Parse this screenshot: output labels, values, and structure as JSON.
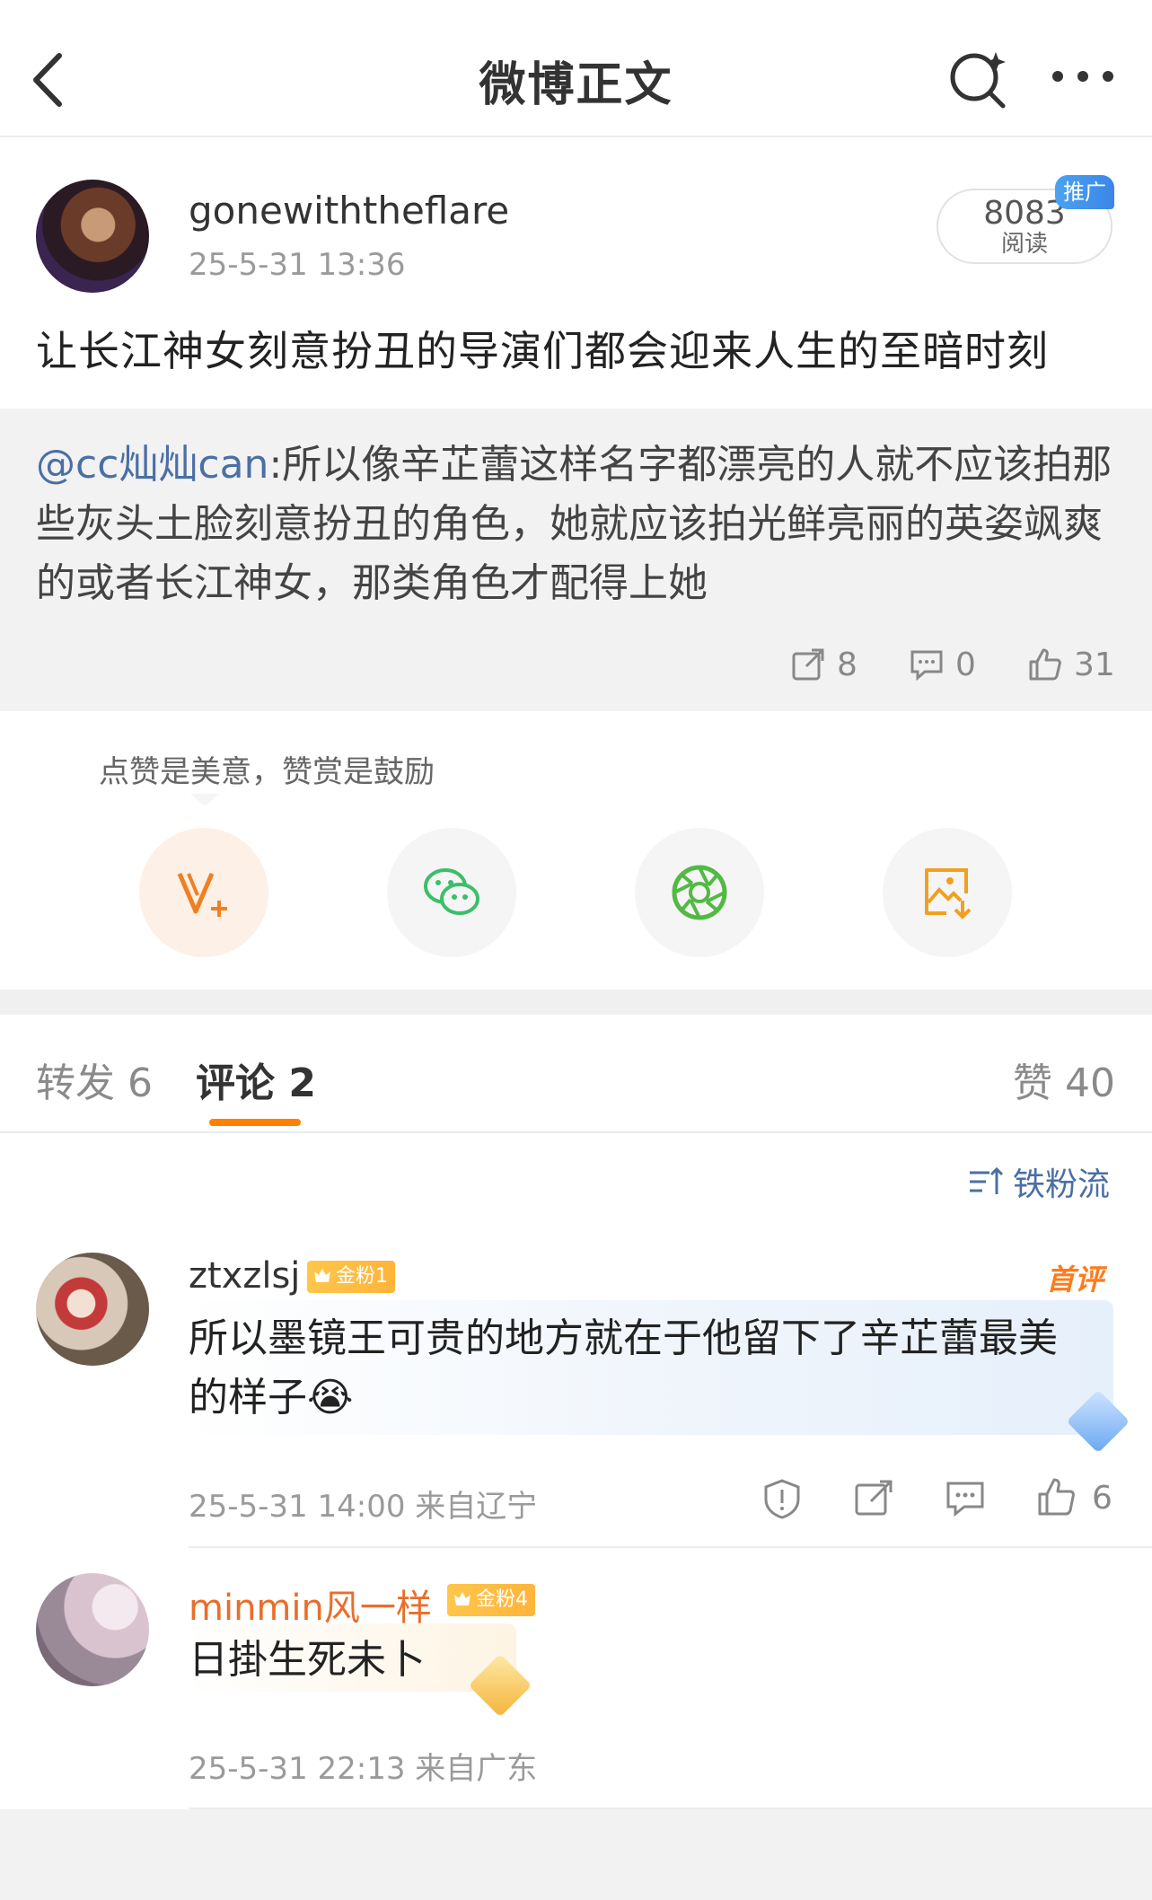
{
  "header": {
    "title": "微博正文"
  },
  "post": {
    "username": "gonewiththeflare",
    "time": "25-5-31 13:36",
    "read_count": "8083",
    "read_label": "阅读",
    "promo_tag": "推广",
    "content": "让长江神女刻意扮丑的导演们都会迎来人生的至暗时刻"
  },
  "quoted": {
    "mention": "@cc灿灿can",
    "text": ":所以像辛芷蕾这样名字都漂亮的人就不应该拍那些灰头土脸刻意扮丑的角色，她就应该拍光鲜亮丽的英姿飒爽的或者长江神女，那类角色才配得上她",
    "reposts": "8",
    "comments": "0",
    "likes": "31"
  },
  "reward": {
    "hint": "点赞是美意，赞赏是鼓励",
    "colors": {
      "reward": "#f07f22",
      "wechat": "#3bbf6a",
      "moments": "#52b944",
      "save": "#f0a020"
    }
  },
  "tabs": {
    "repost": "转发 6",
    "comment": "评论 2",
    "likes": "赞 40"
  },
  "sort_label": "铁粉流",
  "comments": [
    {
      "name": "ztxzlsj",
      "badge": "金粉1",
      "first_tag": "首评",
      "text": "所以墨镜王可贵的地方就在于他留下了辛芷蕾最美的样子😭",
      "meta": "25-5-31 14:00  来自辽宁",
      "likes": "6"
    },
    {
      "name": "minmin风一样",
      "badge": "金粉4",
      "text": "日掛生死未卜",
      "meta": "25-5-31 22:13  来自广东"
    }
  ]
}
